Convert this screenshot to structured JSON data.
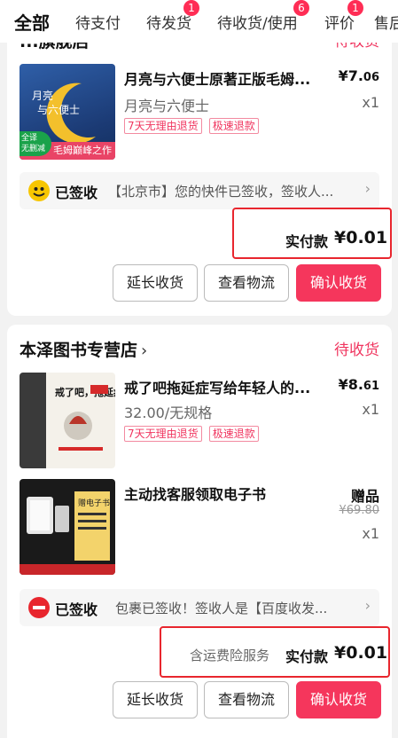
{
  "tabs": [
    {
      "label": "全部",
      "badge": ""
    },
    {
      "label": "待支付",
      "badge": ""
    },
    {
      "label": "待发货",
      "badge": "1"
    },
    {
      "label": "待收货/使用",
      "badge": "6"
    },
    {
      "label": "评价",
      "badge": "1"
    },
    {
      "label": "售后",
      "badge": ""
    }
  ],
  "order1": {
    "shop_name": "...旗舰店",
    "status": "待收货",
    "item": {
      "title": "月亮与六便士原著正版毛姆...",
      "price_int": "¥7.",
      "price_dec": "06",
      "spec": "月亮与六便士",
      "qty": "x1",
      "tags": [
        "7天无理由退货",
        "极速退款"
      ],
      "cover_lines": [
        "月亮",
        "与六便士"
      ],
      "cover_banner": "毛姆巅峰之作",
      "cover_badge": "全译\n无删减"
    },
    "logistics": {
      "status": "已签收",
      "text": "【北京市】您的快件已签收，签收人..."
    },
    "paid_label": "实付款",
    "paid_amount": "¥0.01",
    "buttons": [
      "延长收货",
      "查看物流",
      "确认收货"
    ]
  },
  "order2": {
    "shop_name": "本泽图书专营店",
    "status": "待收货",
    "item": {
      "title": "戒了吧拖延症写给年轻人的...",
      "price_int": "¥8.",
      "price_dec": "61",
      "spec": "32.00/无规格",
      "qty": "x1",
      "tags": [
        "7天无理由退货",
        "极速退款"
      ],
      "cover_title": "戒了吧，拖延症！"
    },
    "gift": {
      "title": "主动找客服领取电子书",
      "label": "赠品",
      "orig_price": "¥69.80",
      "qty": "x1",
      "cover_text": "赠电子书"
    },
    "logistics": {
      "status": "已签收",
      "text": "包裹已签收！签收人是【百度收发..."
    },
    "insurance": "含运费险服务",
    "paid_label": "实付款",
    "paid_amount": "¥0.01",
    "buttons": [
      "延长收货",
      "查看物流",
      "确认收货"
    ]
  },
  "colors": {
    "accent": "#f5365c",
    "highlight_box": "#e8262e"
  }
}
